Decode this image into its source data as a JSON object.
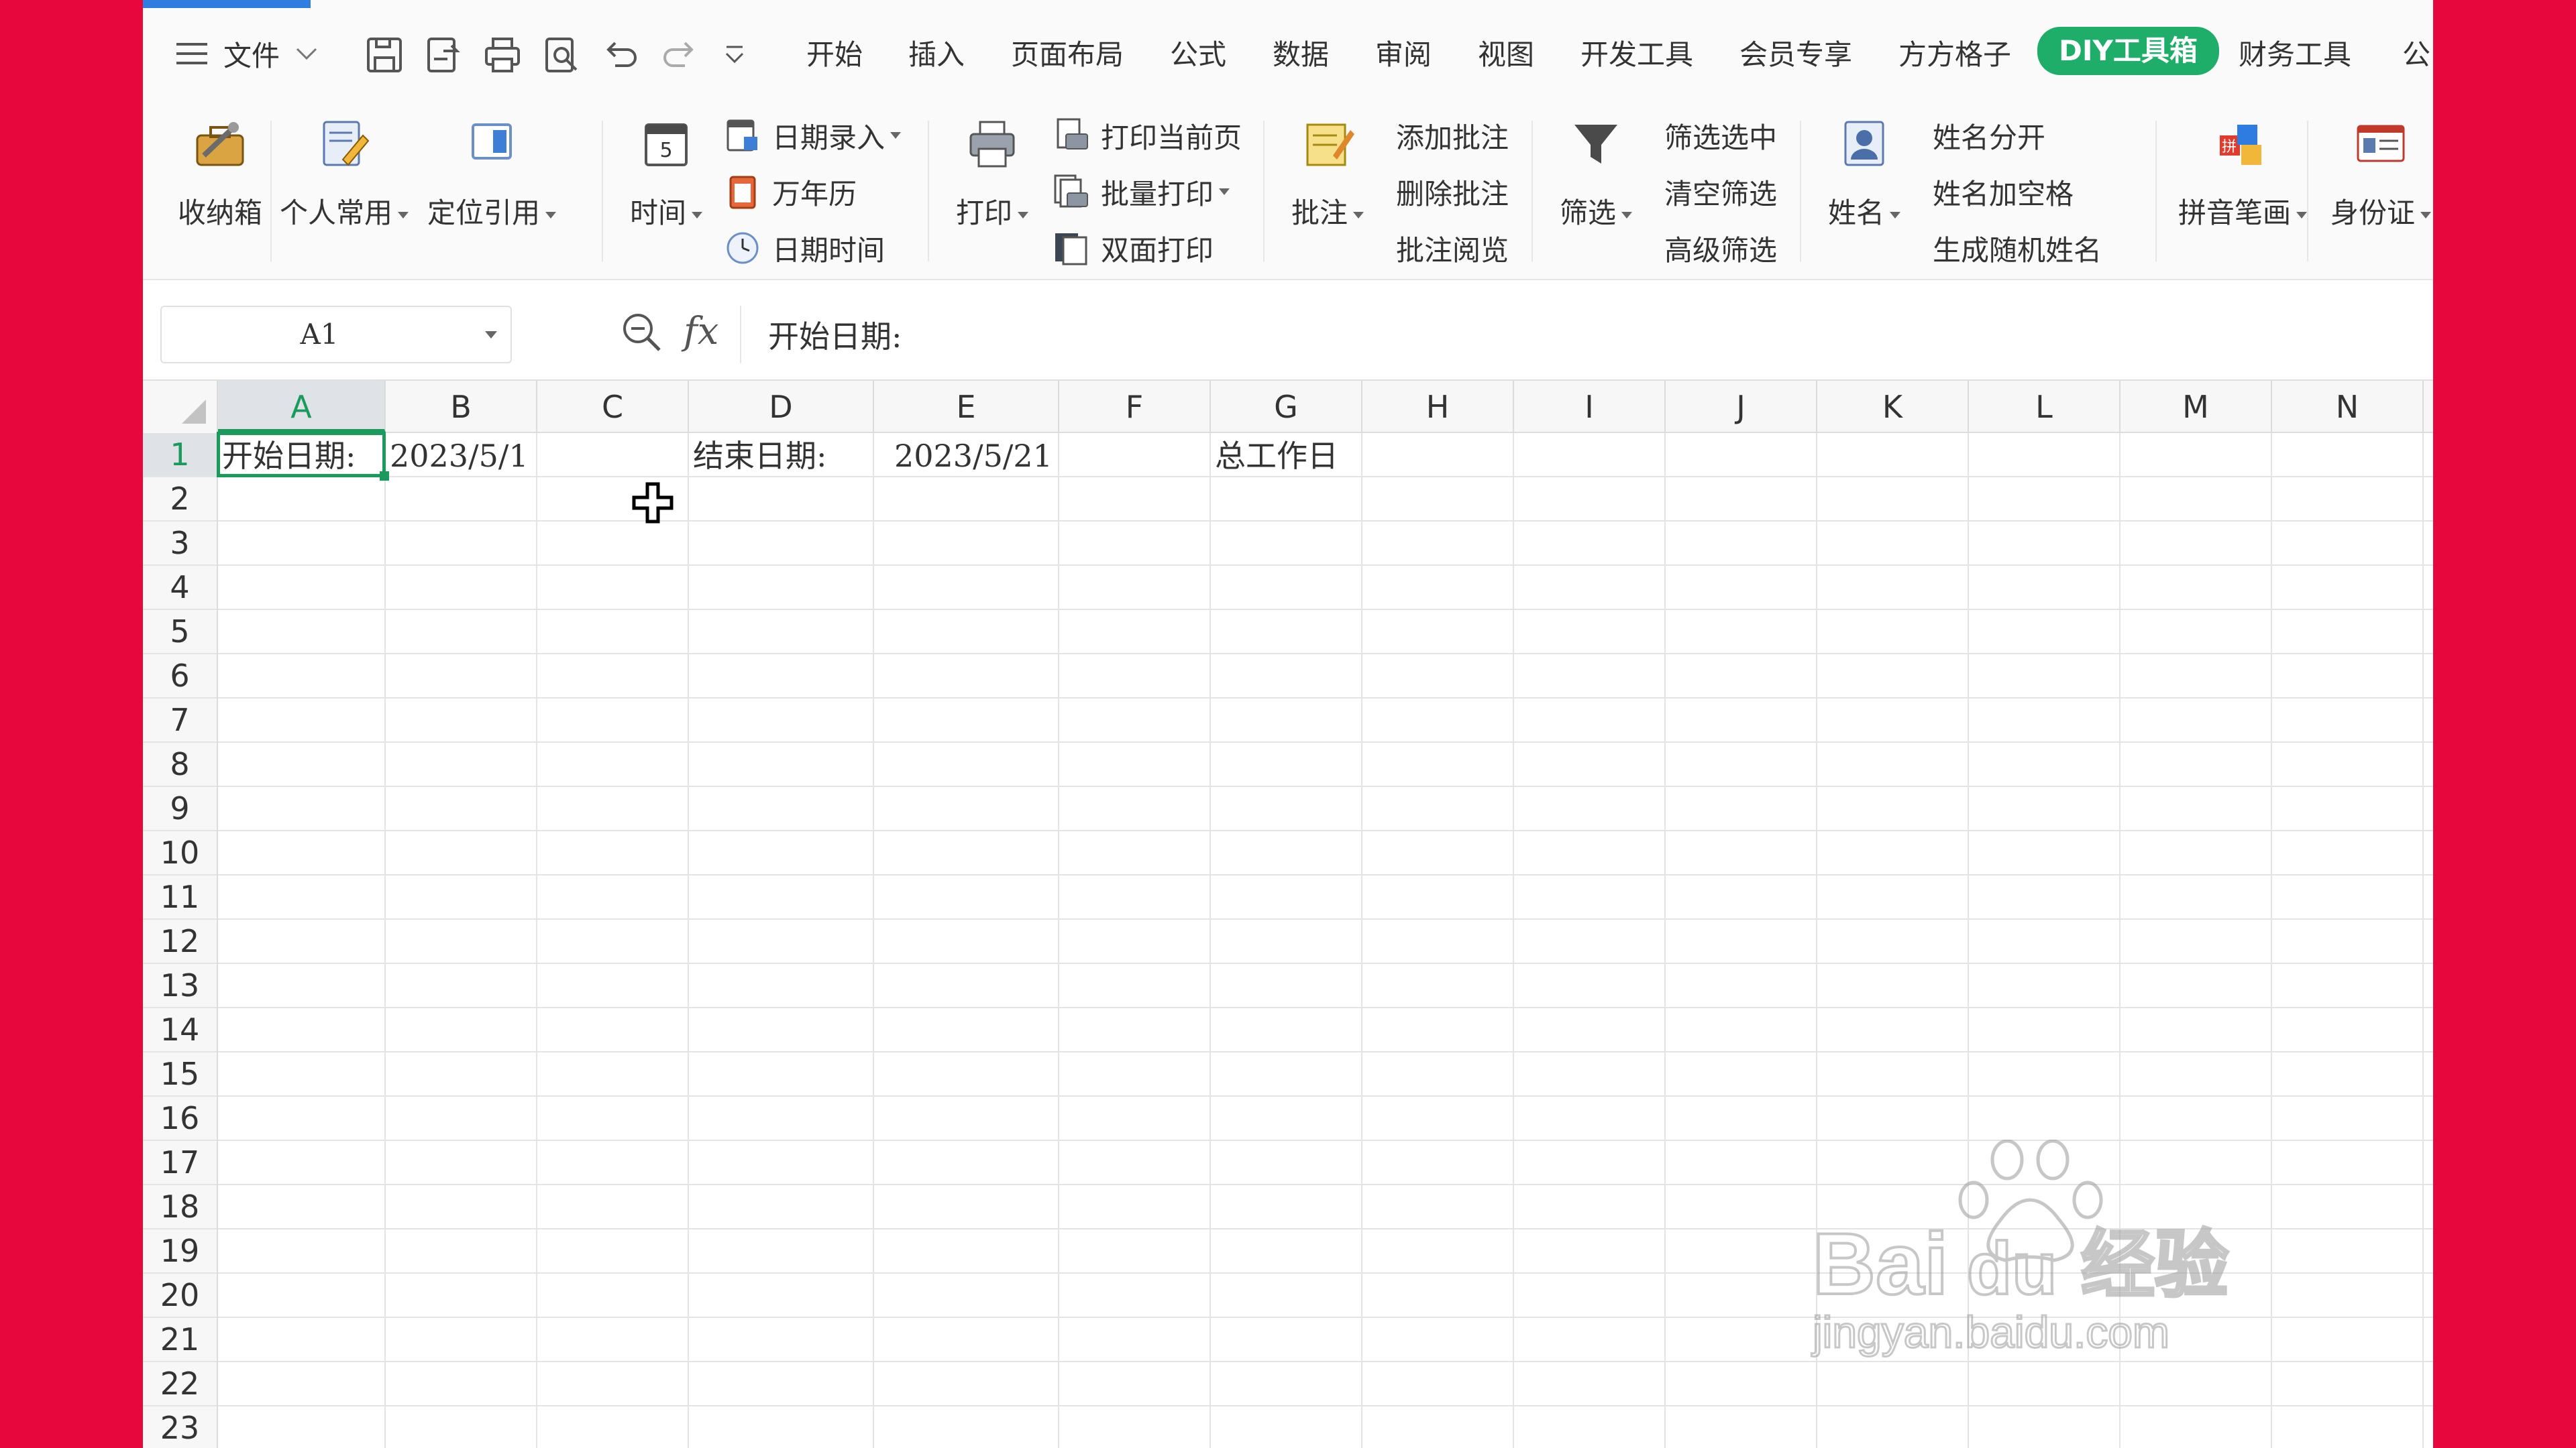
{
  "menu": {
    "file_label": "文件",
    "tabs": [
      "开始",
      "插入",
      "页面布局",
      "公式",
      "数据",
      "审阅",
      "视图",
      "开发工具",
      "会员专享",
      "方方格子",
      "DIY工具箱",
      "财务工具",
      "公"
    ],
    "active_tab": "DIY工具箱"
  },
  "ribbon": {
    "shoujiaxiang": "收纳箱",
    "gerenchangyong": "个人常用",
    "dingweiyinyong": "定位引用",
    "shijian": "时间",
    "riqiluru": "日期录入",
    "wannianli": "万年历",
    "riqishijian": "日期时间",
    "dayin": "打印",
    "dayindangqianye": "打印当前页",
    "piliangdayin": "批量打印",
    "shuangmiandayin": "双面打印",
    "pizhu": "批注",
    "tianjiapizhu": "添加批注",
    "shanchupizhu": "删除批注",
    "pizhuyuelan": "批注阅览",
    "shaixuan": "筛选",
    "shaixuanxuanzhong": "筛选选中",
    "qingkongshaixuan": "清空筛选",
    "gaojishaixuan": "高级筛选",
    "xingming": "姓名",
    "xingmingfenkai": "姓名分开",
    "xingmingjiakongge": "姓名加空格",
    "shengchengsuijixingming": "生成随机姓名",
    "pinyinbihua": "拼音笔画",
    "shenfenzheng": "身份证"
  },
  "formula_bar": {
    "name_box": "A1",
    "fx_label": "fx",
    "value": "开始日期:"
  },
  "sheet": {
    "columns": [
      "A",
      "B",
      "C",
      "D",
      "E",
      "F",
      "G",
      "H",
      "I",
      "J",
      "K",
      "L",
      "M",
      "N"
    ],
    "selected_column": "A",
    "rows": [
      "1",
      "2",
      "3",
      "4",
      "5",
      "6",
      "7",
      "8",
      "9",
      "10",
      "11",
      "12",
      "13",
      "14",
      "15",
      "16",
      "17",
      "18",
      "19",
      "20",
      "21",
      "22",
      "23"
    ],
    "selected_row": "1",
    "cells": {
      "A1": "开始日期:",
      "B1": "2023/5/1",
      "D1": "结束日期:",
      "E1": "2023/5/21",
      "G1": "总工作日"
    }
  },
  "watermark": {
    "brand": "Bai du 经验",
    "url": "jingyan.baidu.com"
  },
  "colors": {
    "accent_green": "#1fae6a",
    "background_red": "#e8073d",
    "progress_blue": "#2f7de1"
  }
}
